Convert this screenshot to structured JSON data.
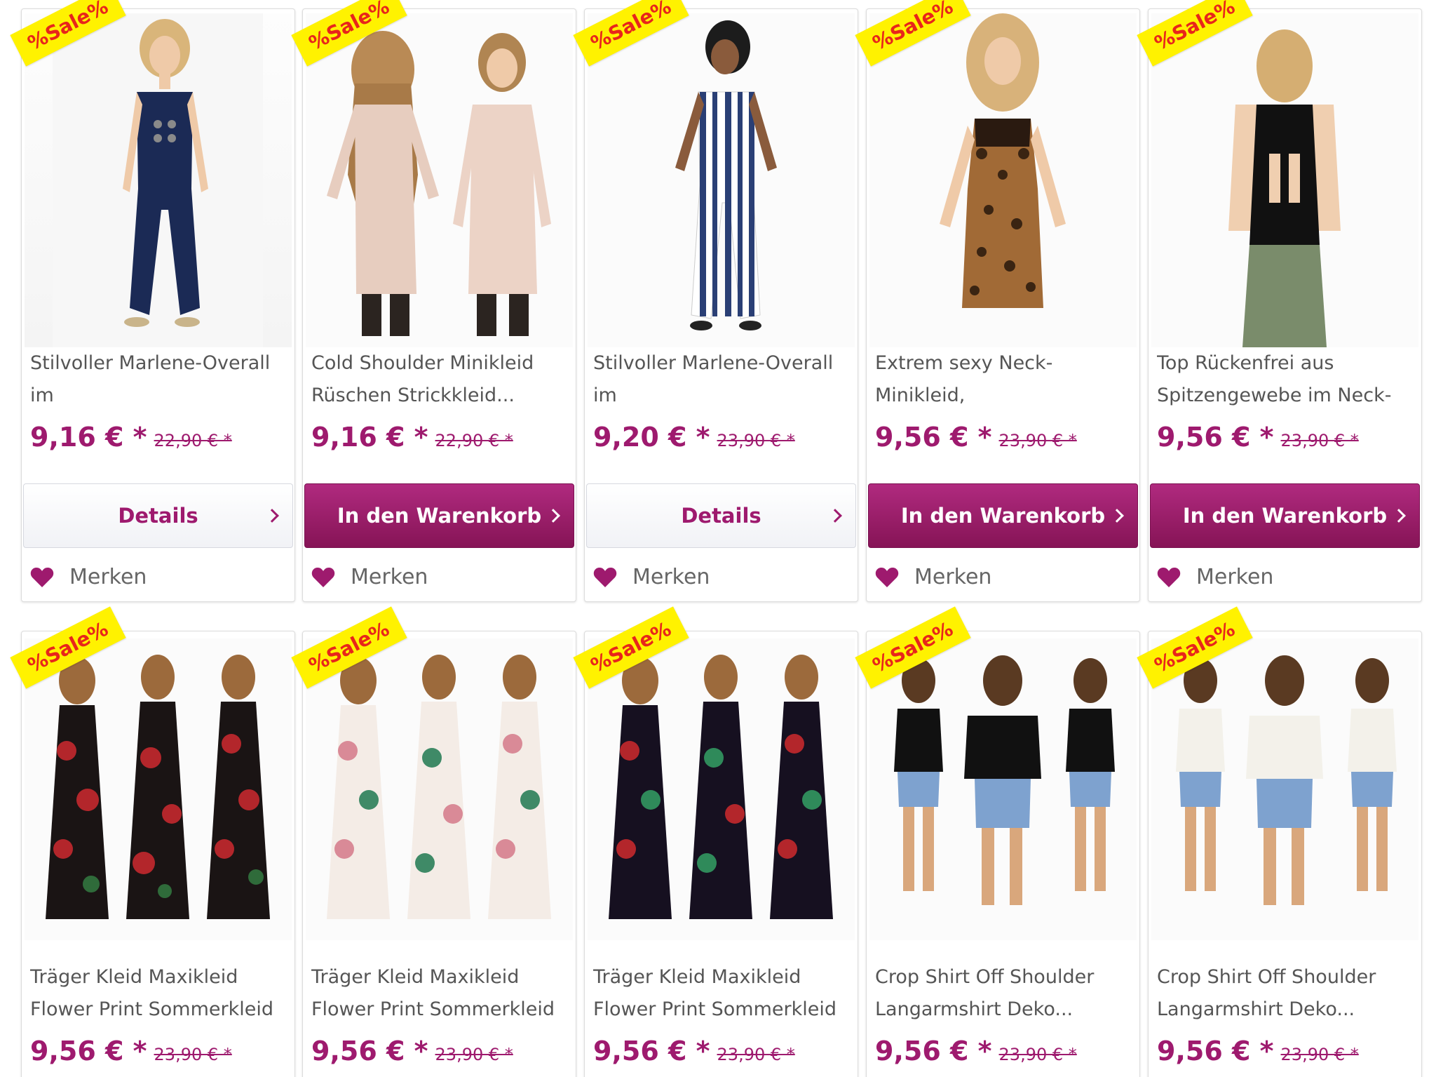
{
  "sale_badge": "%Sale%",
  "buttons": {
    "details": "Details",
    "cart": "In den Warenkorb",
    "merken": "Merken"
  },
  "colors": {
    "accent": "#9e1a6e",
    "badge_bg": "#fff200",
    "badge_text": "#e8251b"
  },
  "products": [
    {
      "title": "Stilvoller Marlene-Overall im\nLong-Style mit...",
      "price": "9,16 € *",
      "old_price": "22,90 € *",
      "button": "Details"
    },
    {
      "title": "Cold Shoulder Minikleid\nRüschen Strickkleid...",
      "price": "9,16 € *",
      "old_price": "22,90 € *",
      "button": "In den Warenkorb"
    },
    {
      "title": "Stilvoller Marlene-Overall im\nLong-Style mit...",
      "price": "9,20 € *",
      "old_price": "23,90 € *",
      "button": "Details"
    },
    {
      "title": "Extrem sexy Neck-Minikleid,\nTop mit...",
      "price": "9,56 € *",
      "old_price": "23,90 € *",
      "button": "In den Warenkorb"
    },
    {
      "title": "Top Rückenfrei aus\nSpitzengewebe im Neck-",
      "price": "9,56 € *",
      "old_price": "23,90 € *",
      "button": "In den Warenkorb"
    },
    {
      "title": "Träger Kleid Maxikleid\nFlower Print Sommerkleid",
      "price": "9,56 € *",
      "old_price": "23,90 € *"
    },
    {
      "title": "Träger Kleid Maxikleid\nFlower Print Sommerkleid",
      "price": "9,56 € *",
      "old_price": "23,90 € *"
    },
    {
      "title": "Träger Kleid Maxikleid\nFlower Print Sommerkleid",
      "price": "9,56 € *",
      "old_price": "23,90 € *"
    },
    {
      "title": "Crop Shirt Off Shoulder\nLangarmshirt Deko...",
      "price": "9,56 € *",
      "old_price": "23,90 € *"
    },
    {
      "title": "Crop Shirt Off Shoulder\nLangarmshirt Deko...",
      "price": "9,56 € *",
      "old_price": "23,90 € *"
    }
  ]
}
